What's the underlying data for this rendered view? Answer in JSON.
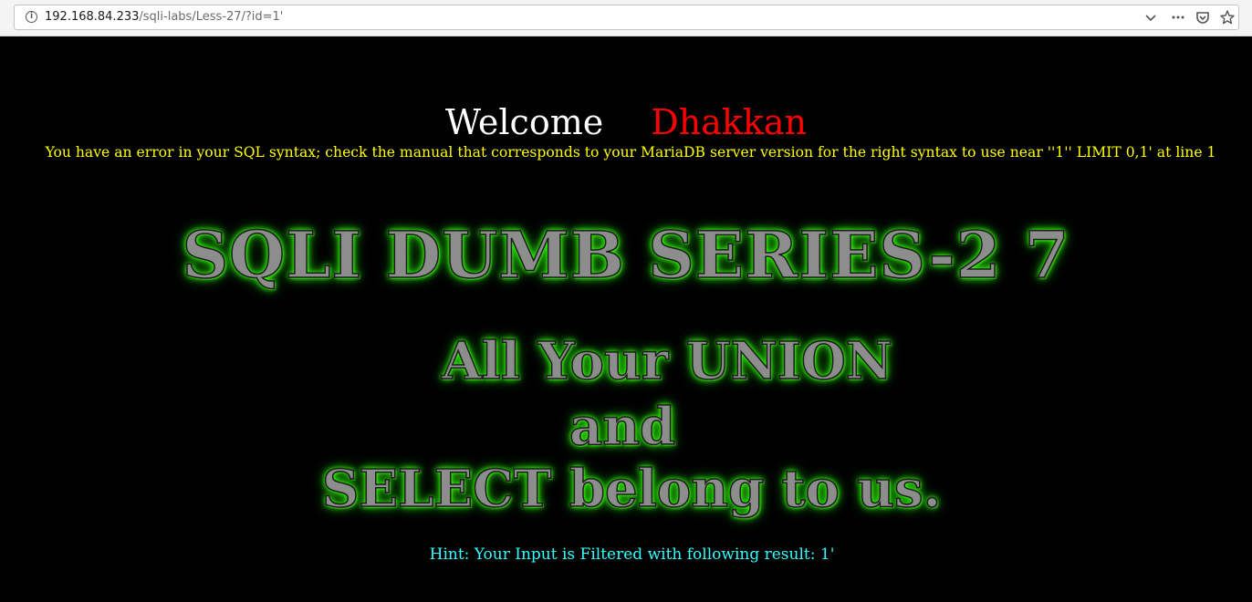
{
  "browser": {
    "url_host": "192.168.84.233",
    "url_path": "/sqli-labs/Less-27/?id=1'",
    "icons": [
      "info-icon",
      "chevron-down-icon",
      "more-icon",
      "pocket-icon",
      "star-icon"
    ]
  },
  "page": {
    "welcome_word": "Welcome",
    "welcome_name": "Dhakkan",
    "error_message": "You have an error in your SQL syntax; check the manual that corresponds to your MariaDB server version for the right syntax to use near ''1'' LIMIT 0,1' at line 1",
    "title": "SQLI DUMB SERIES-2 7",
    "tagline_1": "All Your UNION",
    "tagline_2": "and",
    "tagline_3": "SELECT belong to us.",
    "hint": "Hint: Your Input is Filtered with following result: 1'"
  },
  "colors": {
    "background": "#000000",
    "welcome": "#ffffff",
    "name": "#ff0000",
    "error": "#ffff00",
    "hint": "#33ffff",
    "glow": "#33ff00"
  }
}
